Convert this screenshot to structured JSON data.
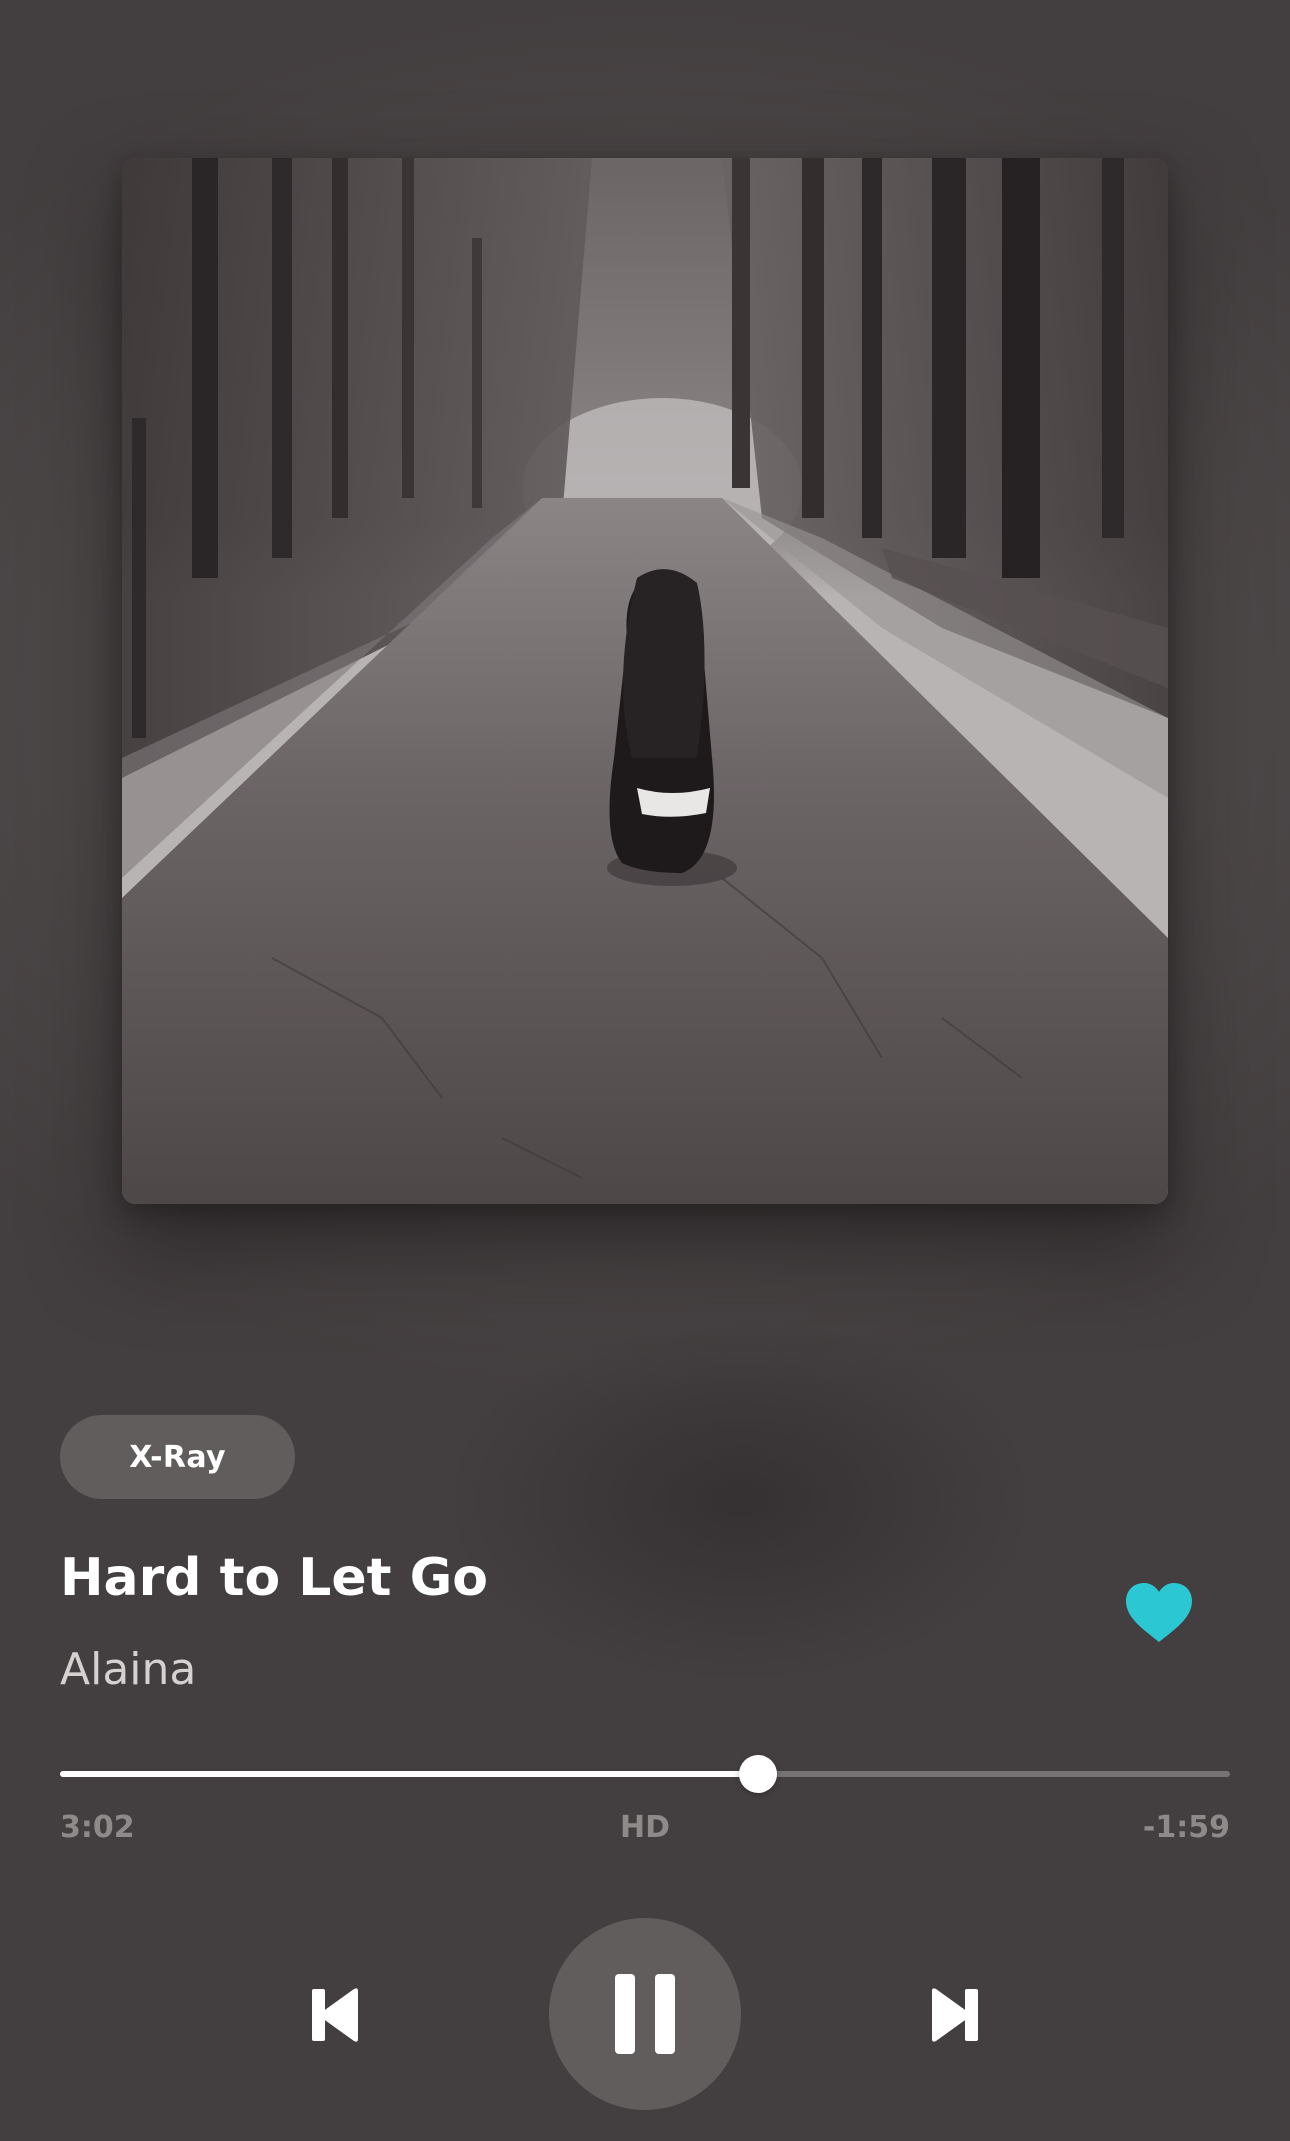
{
  "now_playing": {
    "album_art_icon": "album-art-image",
    "xray_label": "X-Ray",
    "title": "Hard to Let Go",
    "artist": "Alaina",
    "favorite": true,
    "favorite_icon": "heart-icon",
    "accent_color": "#2bc8d3"
  },
  "progress": {
    "fraction": 0.597,
    "elapsed": "3:02",
    "quality": "HD",
    "remaining": "-1:59"
  },
  "controls": {
    "previous_icon": "skip-previous-icon",
    "pause_icon": "pause-icon",
    "next_icon": "skip-next-icon"
  }
}
